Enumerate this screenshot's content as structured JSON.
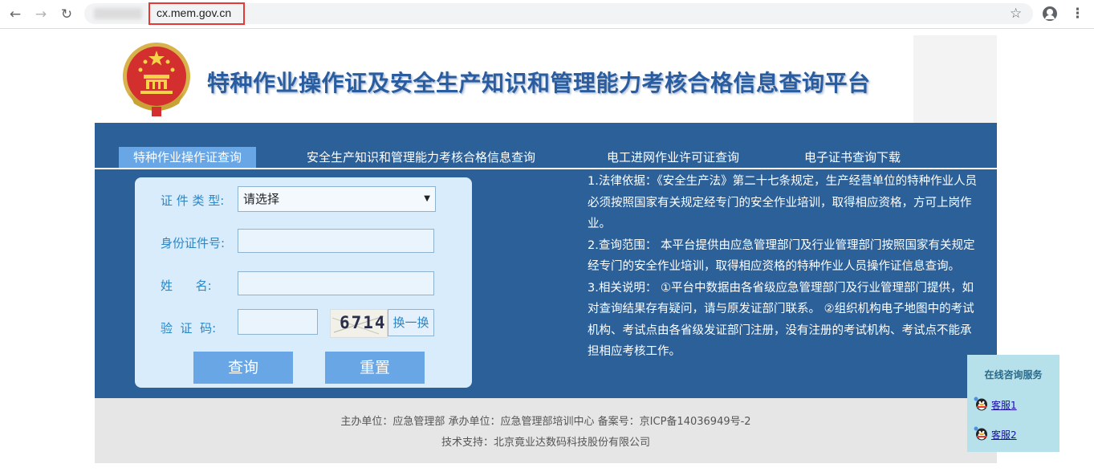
{
  "browser": {
    "url": "cx.mem.gov.cn",
    "back_glyph": "←",
    "forward_glyph": "→",
    "reload_glyph": "↻",
    "star_glyph": "☆",
    "menu_glyph": "⋮"
  },
  "header": {
    "title": "特种作业操作证及安全生产知识和管理能力考核合格信息查询平台"
  },
  "tabs": [
    {
      "label": "特种作业操作证查询",
      "active": true
    },
    {
      "label": "安全生产知识和管理能力考核合格信息查询",
      "active": false
    },
    {
      "label": "电工进网作业许可证查询",
      "active": false
    },
    {
      "label": "电子证书查询下载",
      "active": false
    }
  ],
  "form": {
    "cert_type_label": "证 件 类 型:",
    "cert_type_value": "请选择",
    "id_label": "身份证件号:",
    "name_label": "姓      名:",
    "captcha_label": "验  证  码:",
    "captcha_text": "6714",
    "refresh_label": "换一换",
    "query_label": "查询",
    "reset_label": "重置"
  },
  "info": {
    "p1": "1.法律依据：《安全生产法》第二十七条规定，生产经营单位的特种作业人员必须按照国家有关规定经专门的安全作业培训，取得相应资格，方可上岗作业。",
    "p2": "2.查询范围： 本平台提供由应急管理部门及行业管理部门按照国家有关规定经专门的安全作业培训，取得相应资格的特种作业人员操作证信息查询。",
    "p3": "3.相关说明： ①平台中数据由各省级应急管理部门及行业管理部门提供，如对查询结果存有疑问，请与原发证部门联系。 ②组织机构电子地图中的考试机构、考试点由各省级发证部门注册，没有注册的考试机构、考试点不能承担相应考核工作。"
  },
  "footer": {
    "line1": "主办单位：应急管理部    承办单位：应急管理部培训中心    备案号：京ICP备14036949号-2",
    "line2": "技术支持：北京竟业达数码科技股份有限公司"
  },
  "consult": {
    "title": "在线咨询服务",
    "items": [
      "客服1",
      "客服2"
    ]
  },
  "colors": {
    "main_blue": "#2b6099",
    "tab_active": "#68a6e6",
    "title_blue": "#2a5d9f",
    "url_highlight": "#e53935"
  }
}
